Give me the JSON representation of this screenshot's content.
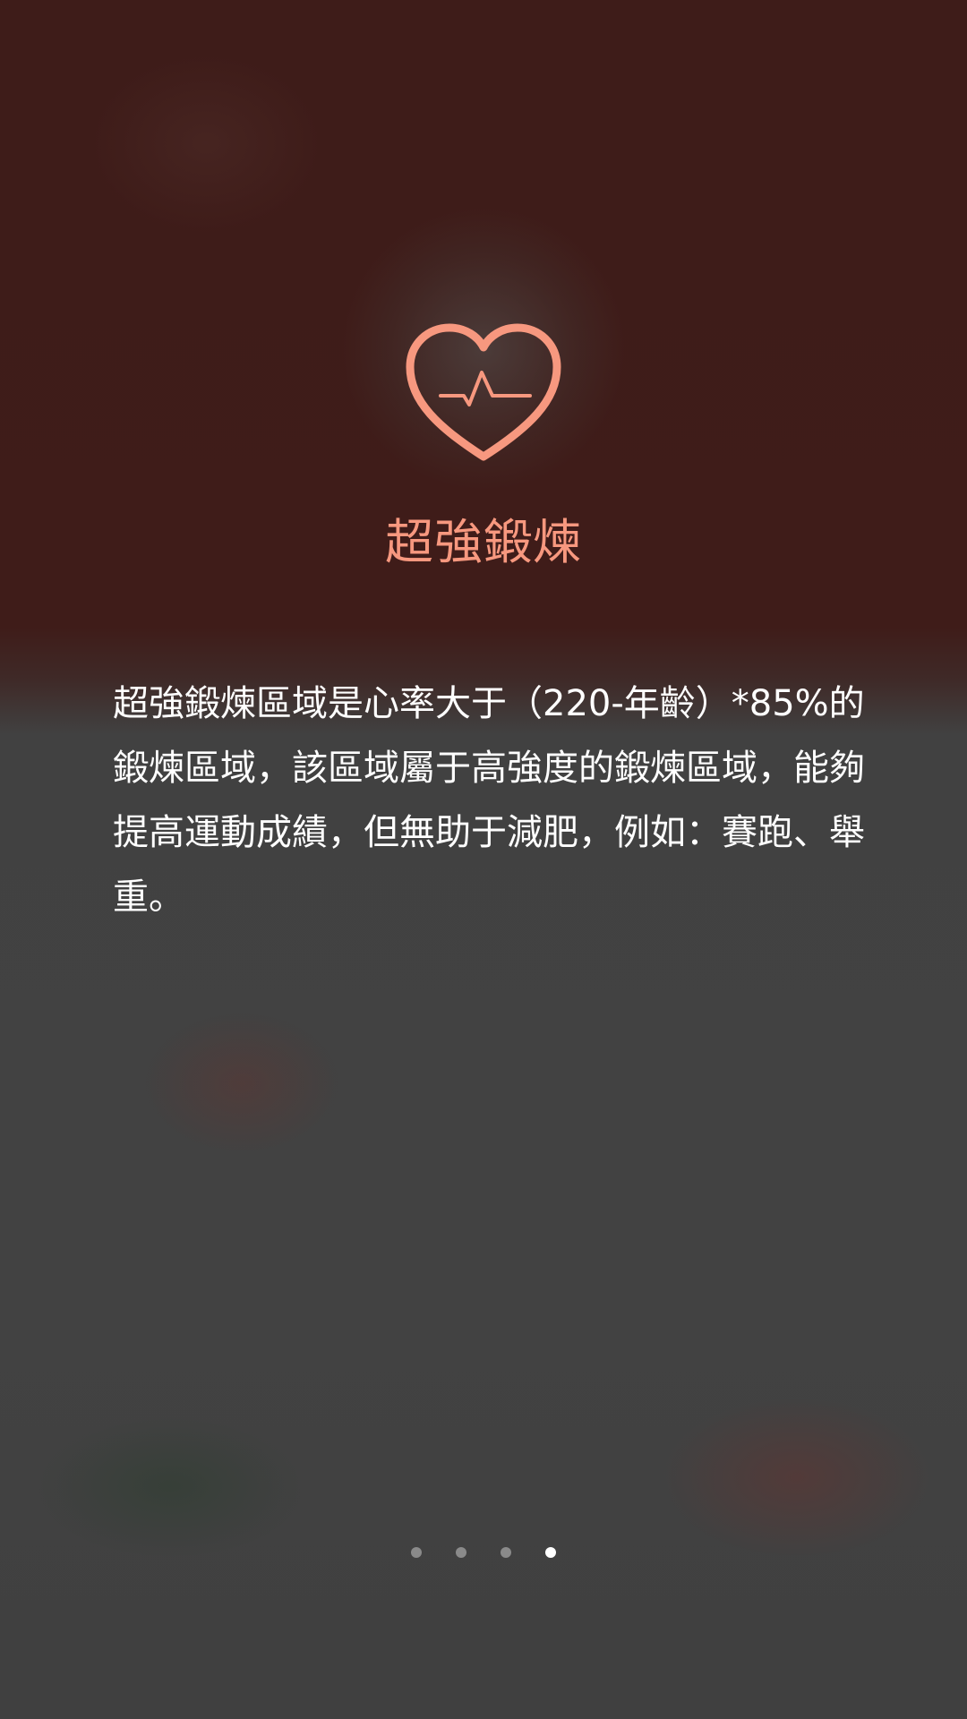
{
  "onboarding": {
    "title": "超強鍛煉",
    "description": "超強鍛煉區域是心率大于（220-年齡）*85%的鍛煉區域，該區域屬于高強度的鍛煉區域，能夠提高運動成績，但無助于減肥，例如：賽跑、舉重。",
    "icon": "heart-pulse-icon",
    "accent_color": "#f7987f"
  },
  "pager": {
    "total_pages": 4,
    "current_page": 4
  }
}
